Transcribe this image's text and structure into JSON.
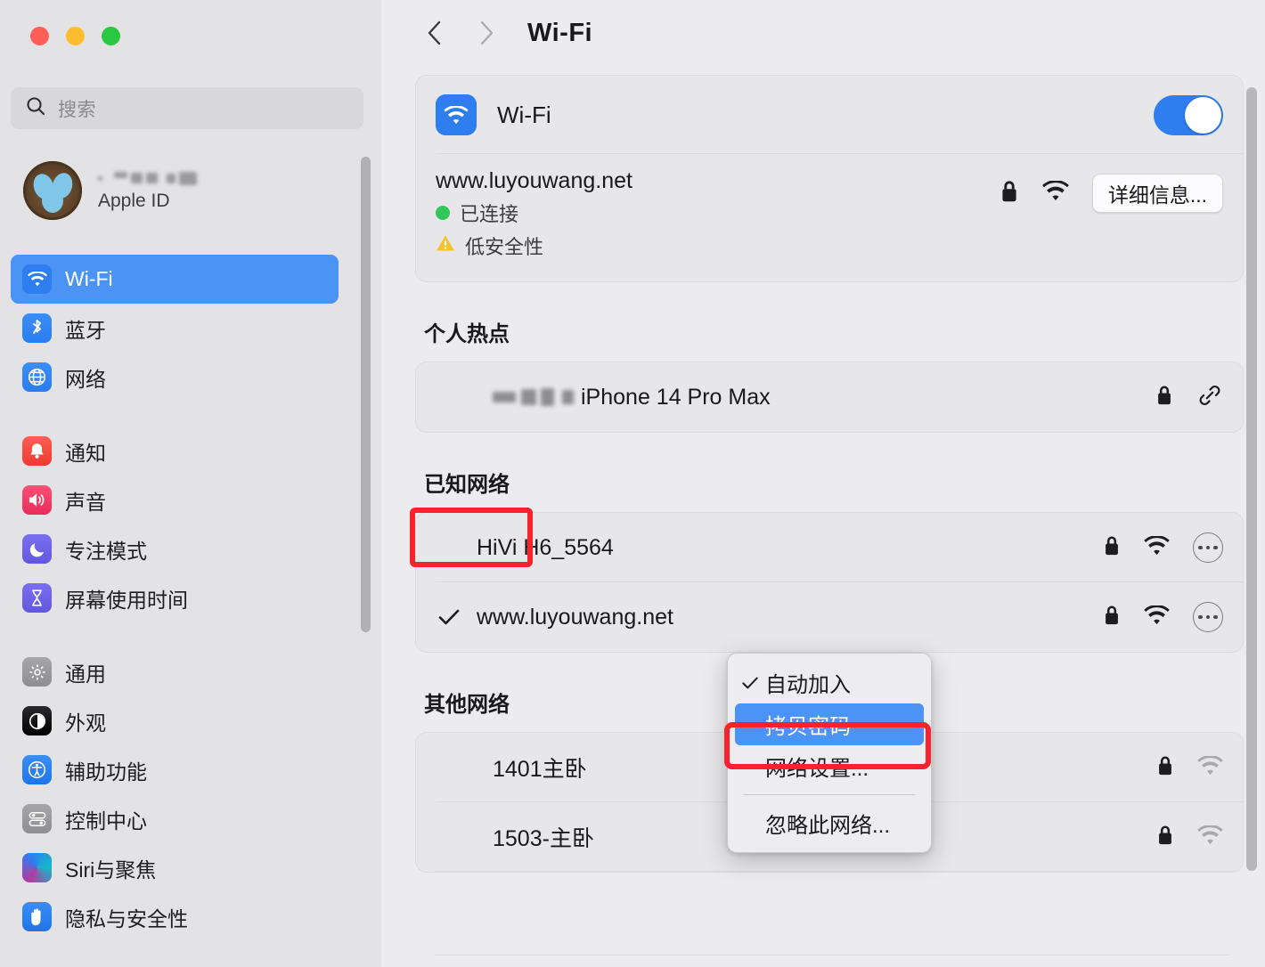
{
  "window": {
    "traffic_lights": [
      "close",
      "minimize",
      "zoom"
    ],
    "colors": {
      "close": "#ff5f57",
      "minimize": "#febc2e",
      "zoom": "#28c840",
      "accent": "#2f7ef0",
      "highlight": "#f6222e"
    }
  },
  "sidebar": {
    "search": {
      "placeholder": "搜索",
      "icon": "search-icon"
    },
    "account": {
      "name_blurred": true,
      "subtitle": "Apple ID",
      "avatar": "bird-nest-eggs-avatar"
    },
    "groups": [
      {
        "items": [
          {
            "label": "Wi-Fi",
            "icon": "wifi-icon",
            "selected": true
          },
          {
            "label": "蓝牙",
            "icon": "bluetooth-icon",
            "selected": false
          },
          {
            "label": "网络",
            "icon": "globe-icon",
            "selected": false
          }
        ]
      },
      {
        "items": [
          {
            "label": "通知",
            "icon": "bell-icon",
            "selected": false
          },
          {
            "label": "声音",
            "icon": "speaker-icon",
            "selected": false
          },
          {
            "label": "专注模式",
            "icon": "moon-icon",
            "selected": false
          },
          {
            "label": "屏幕使用时间",
            "icon": "hourglass-icon",
            "selected": false
          }
        ]
      },
      {
        "items": [
          {
            "label": "通用",
            "icon": "gear-icon",
            "selected": false
          },
          {
            "label": "外观",
            "icon": "appearance-icon",
            "selected": false
          },
          {
            "label": "辅助功能",
            "icon": "accessibility-icon",
            "selected": false
          },
          {
            "label": "控制中心",
            "icon": "control-center-icon",
            "selected": false
          },
          {
            "label": "Siri与聚焦",
            "icon": "siri-icon",
            "selected": false
          },
          {
            "label": "隐私与安全性",
            "icon": "hand-privacy-icon",
            "selected": false
          }
        ]
      }
    ]
  },
  "main": {
    "nav": {
      "back_icon": "chevron-left-icon",
      "forward_icon": "chevron-right-icon"
    },
    "title": "Wi-Fi",
    "wifi_toggle": {
      "label": "Wi-Fi",
      "icon": "wifi-icon",
      "state": "on"
    },
    "connected": {
      "ssid": "www.luyouwang.net",
      "status_label": "已连接",
      "security_label": "低安全性",
      "lock_icon": "lock-icon",
      "signal_icon": "wifi-signal-icon",
      "details_button": "详细信息..."
    },
    "hotspot_section": {
      "title": "个人热点",
      "items": [
        {
          "name_blurred": true,
          "name": "iPhone 14 Pro Max",
          "lock_icon": "lock-icon",
          "link_icon": "link-icon"
        }
      ]
    },
    "known_section": {
      "title": "已知网络",
      "highlighted": true,
      "items": [
        {
          "ssid": "HiVi H6_5564",
          "connected": false,
          "lock_icon": "lock-icon",
          "signal_icon": "wifi-signal-icon",
          "more_icon": "ellipsis-circle-icon"
        },
        {
          "ssid": "www.luyouwang.net",
          "connected": true,
          "lock_icon": "lock-icon",
          "signal_icon": "wifi-signal-icon",
          "more_icon": "ellipsis-circle-icon"
        }
      ]
    },
    "other_section": {
      "title": "其他网络",
      "items": [
        {
          "ssid": "1401主卧",
          "lock_icon": "lock-icon",
          "signal_icon": "wifi-signal-weak-icon"
        },
        {
          "ssid": "1503-主卧",
          "lock_icon": "lock-icon",
          "signal_icon": "wifi-signal-weak-icon"
        }
      ]
    }
  },
  "context_menu": {
    "items": [
      {
        "label": "自动加入",
        "checked": true,
        "selected": false
      },
      {
        "label": "拷贝密码",
        "checked": false,
        "selected": true,
        "highlighted": true
      },
      {
        "label": "网络设置...",
        "checked": false,
        "selected": false
      },
      {
        "separator_after": true
      },
      {
        "label": "忽略此网络...",
        "checked": false,
        "selected": false
      }
    ]
  },
  "annotations": {
    "arrow": {
      "color": "#f6222e",
      "direction": "left",
      "points_to": "拷贝密码"
    }
  }
}
